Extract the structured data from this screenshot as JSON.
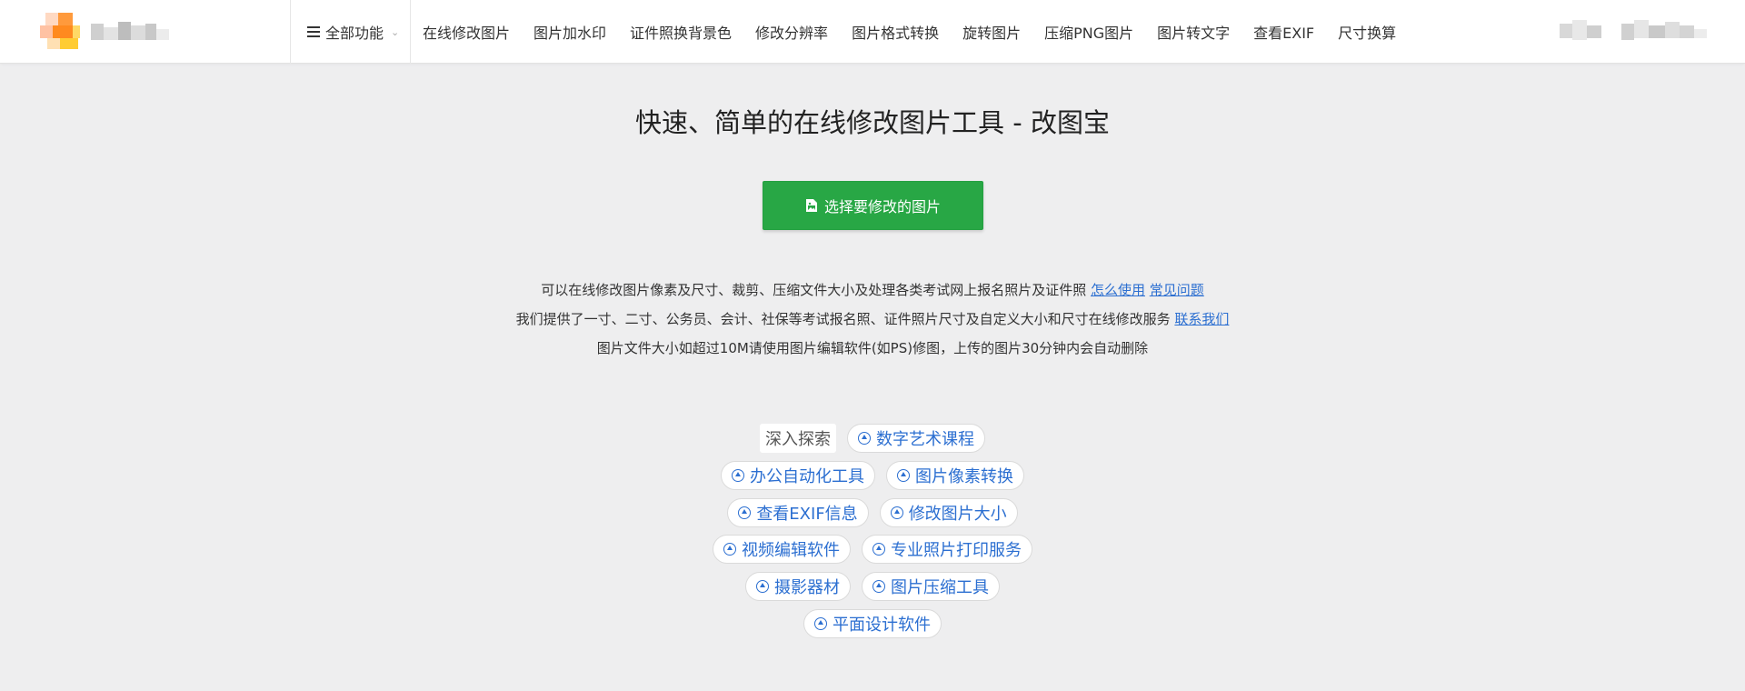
{
  "header": {
    "all_features": "全部功能",
    "nav": [
      "在线修改图片",
      "图片加水印",
      "证件照换背景色",
      "修改分辨率",
      "图片格式转换",
      "旋转图片",
      "压缩PNG图片",
      "图片转文字",
      "查看EXIF",
      "尺寸换算"
    ],
    "brand_color": "#ff9a1f"
  },
  "main": {
    "headline": "快速、简单的在线修改图片工具 - 改图宝",
    "upload_button": "选择要修改的图片",
    "upload_color": "#28a745",
    "desc_line1": "可以在线修改图片像素及尺寸、裁剪、压缩文件大小及处理各类考试网上报名照片及证件照",
    "link_how_to": "怎么使用",
    "link_faq": "常见问题",
    "desc_line2": "我们提供了一寸、二寸、公务员、会计、社保等考试报名照、证件照片尺寸及自定义大小和尺寸在线修改服务",
    "link_contact": "联系我们",
    "desc_line3": "图片文件大小如超过10M请使用图片编辑软件(如PS)修图，上传的图片30分钟内会自动删除"
  },
  "explore": {
    "label": "深入探索",
    "tags": [
      "数字艺术课程",
      "办公自动化工具",
      "图片像素转换",
      "查看EXIF信息",
      "修改图片大小",
      "视频编辑软件",
      "专业照片打印服务",
      "摄影器材",
      "图片压缩工具",
      "平面设计软件"
    ],
    "link_color": "#2c6fd1"
  }
}
